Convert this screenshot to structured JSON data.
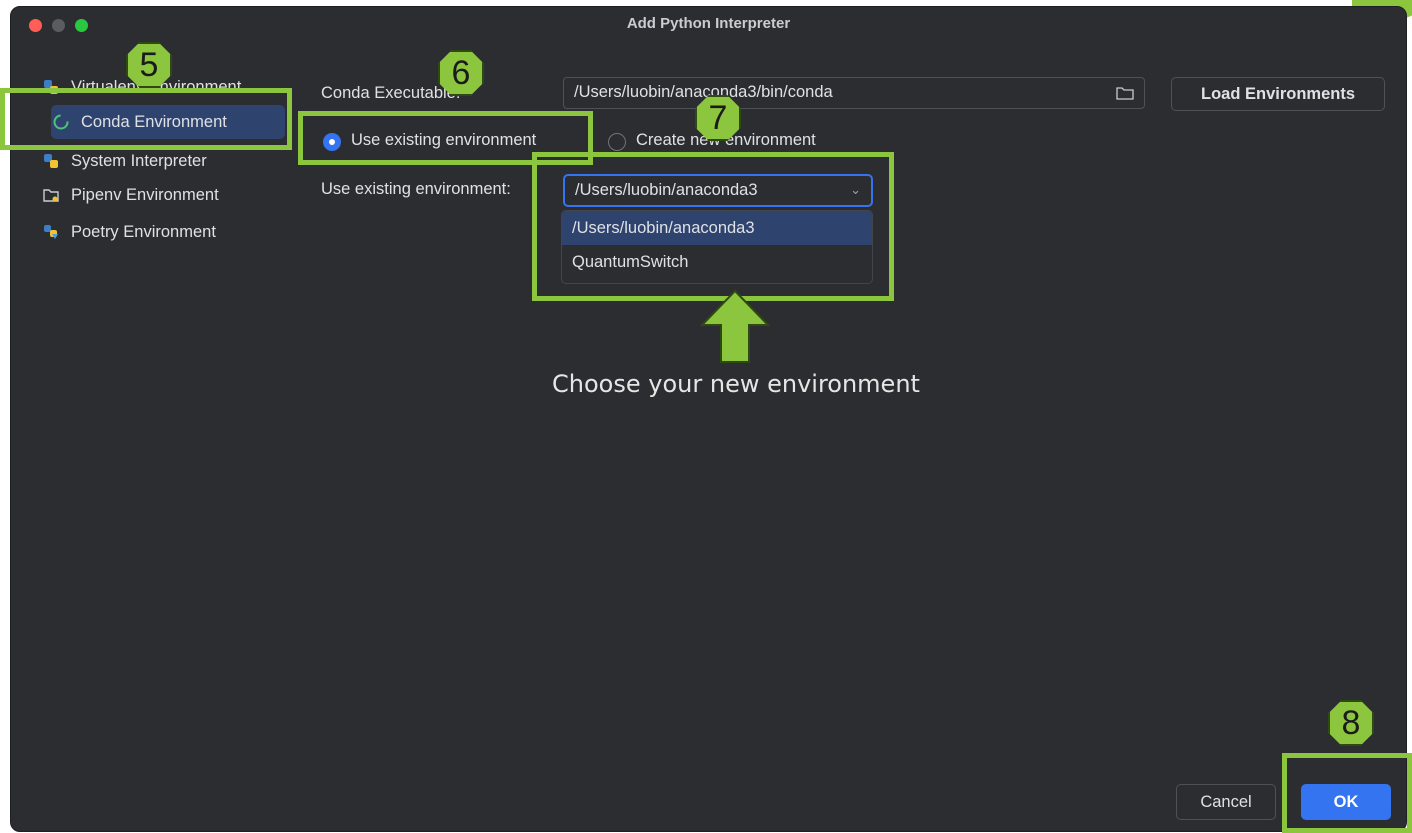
{
  "window": {
    "title": "Add Python Interpreter"
  },
  "sidebar": {
    "items": [
      {
        "label": "Virtualenv Environment",
        "icon": "python-icon"
      },
      {
        "label": "Conda Environment",
        "icon": "conda-icon",
        "selected": true
      },
      {
        "label": "System Interpreter",
        "icon": "python-icon"
      },
      {
        "label": "Pipenv Environment",
        "icon": "pipenv-folder-icon"
      },
      {
        "label": "Poetry Environment",
        "icon": "poetry-icon"
      }
    ]
  },
  "main": {
    "conda_executable_label": "Conda Executable:",
    "conda_executable_value": "/Users/luobin/anaconda3/bin/conda",
    "load_environments_label": "Load Environments",
    "radio_use_existing": "Use existing environment",
    "radio_create_new": "Create new environment",
    "use_existing_label": "Use existing environment:",
    "selected_environment": "/Users/luobin/anaconda3",
    "environment_options": [
      "/Users/luobin/anaconda3",
      "QuantumSwitch"
    ]
  },
  "footer": {
    "cancel_label": "Cancel",
    "ok_label": "OK"
  },
  "annotations": {
    "badges": [
      "5",
      "6",
      "7",
      "8"
    ],
    "caption": "Choose your new environment",
    "accent_color": "#8cc63f"
  },
  "colors": {
    "background": "#2b2d30",
    "selection": "#2e436e",
    "primary_button": "#3574f0"
  }
}
